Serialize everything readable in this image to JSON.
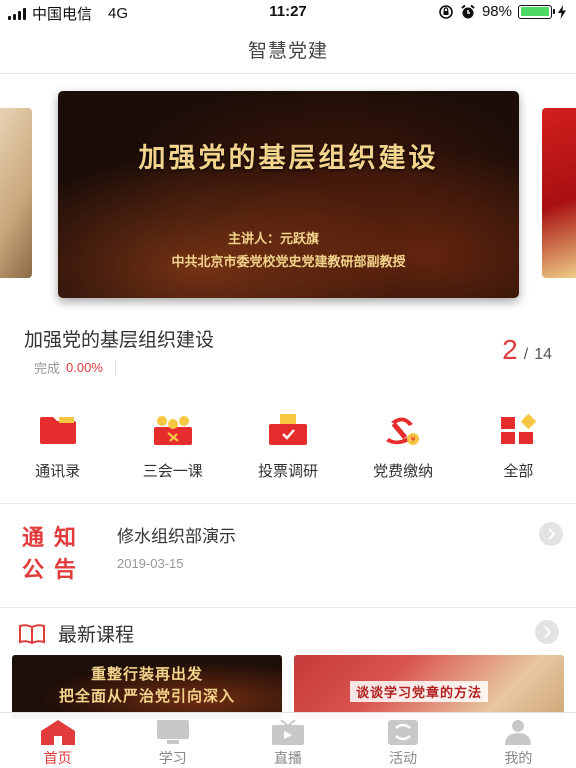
{
  "status_bar": {
    "carrier": "中国电信",
    "network": "4G",
    "time": "11:27",
    "battery": "98%",
    "battery_level": 0.98
  },
  "nav": {
    "title": "智慧党建"
  },
  "banner": {
    "title": "加强党的基层组织建设",
    "speaker": "主讲人：元跃旗",
    "org": "中共北京市委党校党史党建教研部副教授"
  },
  "course": {
    "title": "加强党的基层组织建设",
    "progress_label": "完成",
    "progress_value": "0.00%",
    "current_page": "2",
    "separator": "/",
    "total_pages": "14"
  },
  "quick_menu": [
    {
      "label": "通讯录",
      "icon": "folder-icon"
    },
    {
      "label": "三会一课",
      "icon": "meeting-icon"
    },
    {
      "label": "投票调研",
      "icon": "vote-icon"
    },
    {
      "label": "党费缴纳",
      "icon": "party-fee-icon"
    },
    {
      "label": "全部",
      "icon": "grid-icon"
    }
  ],
  "notice": {
    "badge_line1": "通知",
    "badge_line2": "公告",
    "title": "修水组织部演示",
    "date": "2019-03-15"
  },
  "latest": {
    "title": "最新课程",
    "cards": [
      {
        "line1": "重整行装再出发",
        "line2": "把全面从严治党引向深入"
      },
      {
        "line1": "谈谈学习党章的方法"
      }
    ]
  },
  "tabs": [
    {
      "label": "首页",
      "icon": "home-icon",
      "active": true
    },
    {
      "label": "学习",
      "icon": "monitor-icon",
      "active": false
    },
    {
      "label": "直播",
      "icon": "tv-icon",
      "active": false
    },
    {
      "label": "活动",
      "icon": "activity-icon",
      "active": false
    },
    {
      "label": "我的",
      "icon": "user-icon",
      "active": false
    }
  ],
  "colors": {
    "accent": "#e23b3b",
    "battery_green": "#4cd964",
    "tab_inactive": "#c8c8c8"
  }
}
